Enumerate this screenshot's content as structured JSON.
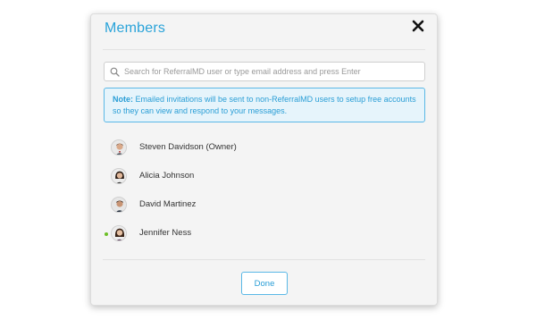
{
  "modal": {
    "title": "Members",
    "close_icon": "close-icon",
    "search": {
      "placeholder": "Search for ReferralMD user or type email address and press Enter",
      "value": "",
      "icon": "search-icon"
    },
    "note": {
      "label": "Note:",
      "text": " Emailed invitations will be sent to non-ReferralMD users to setup free accounts so they can view and respond to your messages."
    },
    "members": [
      {
        "name": "Steven Davidson (Owner)",
        "online": false
      },
      {
        "name": "Alicia Johnson",
        "online": false
      },
      {
        "name": "David Martinez",
        "online": false
      },
      {
        "name": "Jennifer Ness",
        "online": true
      }
    ],
    "done_label": "Done"
  },
  "colors": {
    "accent": "#29a3d9",
    "note_bg": "#e6f4fb",
    "online": "#6cbf26"
  }
}
